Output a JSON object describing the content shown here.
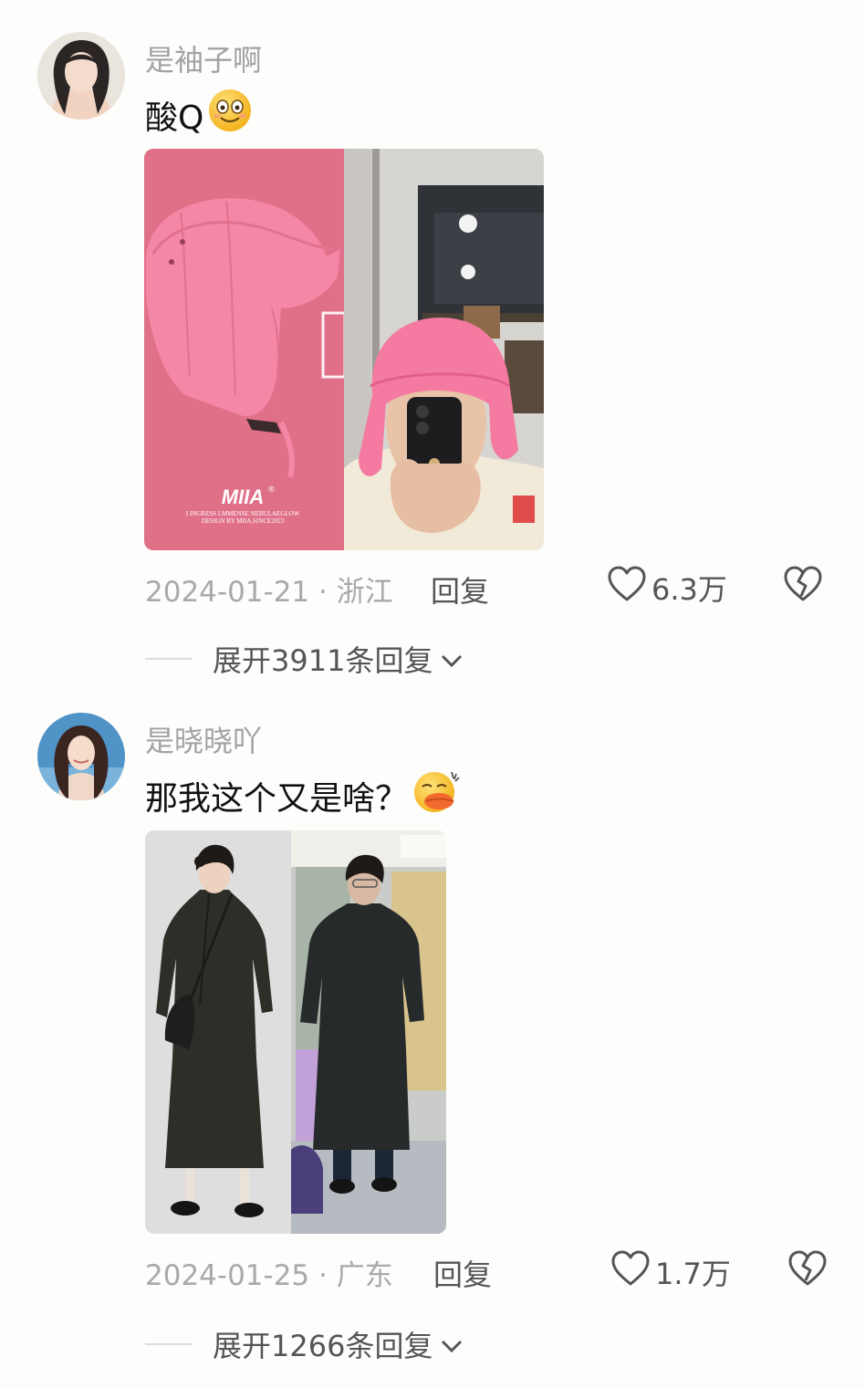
{
  "comments": [
    {
      "username": "是袖子啊",
      "text": "酸Q",
      "emoji_icon": "smiling-face-emoji",
      "date_location": "2024-01-21 · 浙江",
      "reply_label": "回复",
      "likes": "6.3万",
      "expand_label": "展开3911条回复",
      "photo_left_logo": "MIIA®",
      "photo_left_caption": "I INGRESS I.MMENSE NEBULAEGLOW\nDESIGN BY MIIA,SINCE2023",
      "accent": "#e06f88"
    },
    {
      "username": "是晓晓吖",
      "text": "那我这个又是啥？",
      "emoji_icon": "duck-lips-emoji",
      "date_location": "2024-01-25 · 广东",
      "reply_label": "回复",
      "likes": "1.7万",
      "expand_label": "展开1266条回复"
    }
  ],
  "colors": {
    "background": "#fdfdfb",
    "username": "#a2a2a2",
    "meta": "#a9a9a9"
  }
}
